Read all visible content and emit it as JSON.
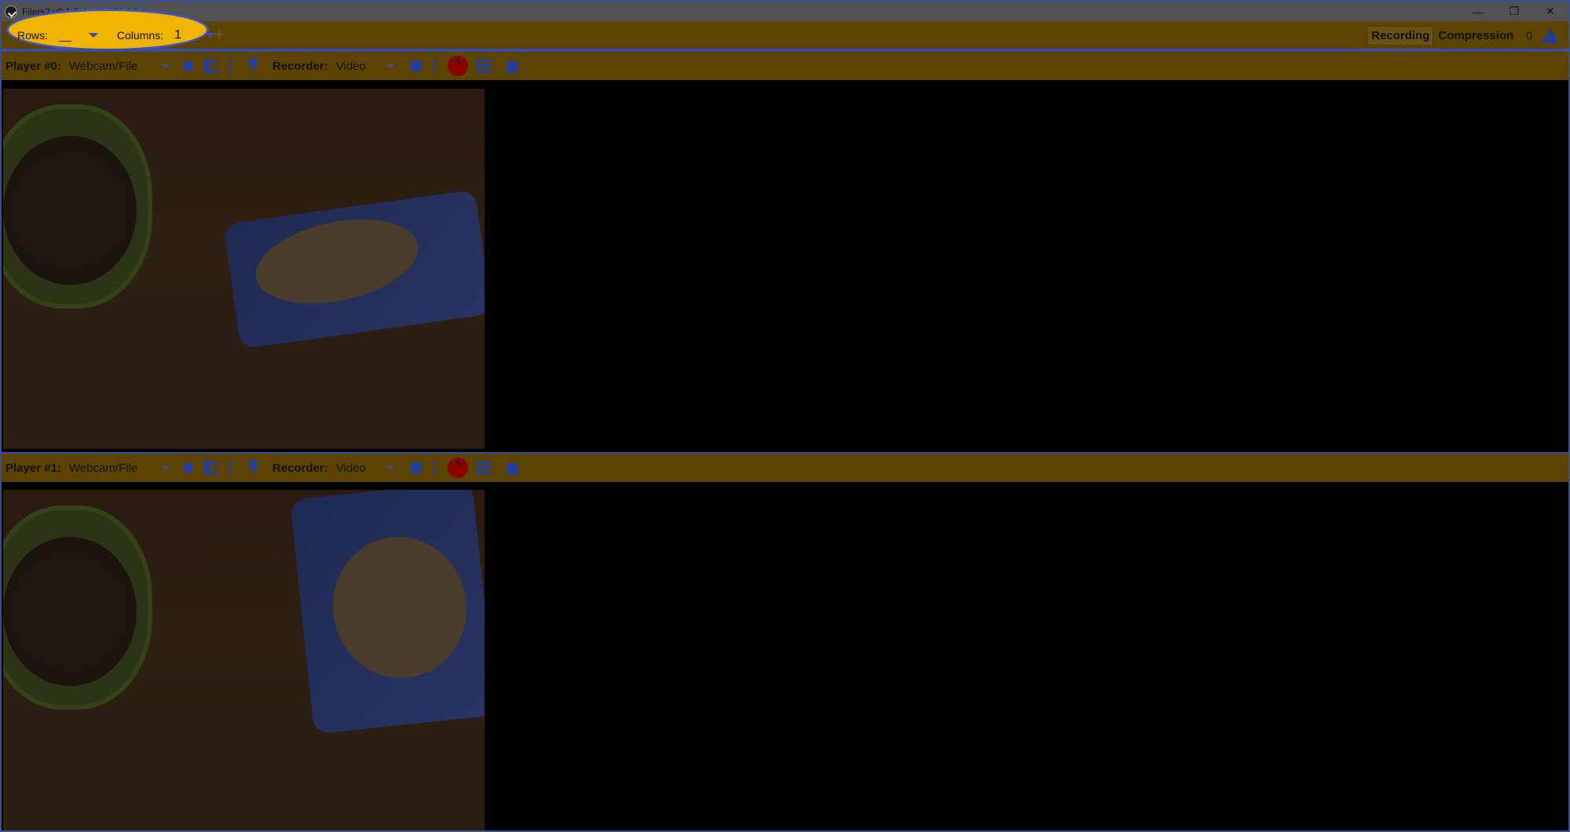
{
  "window": {
    "title": "Filers2 v0.1.0.dev0, CPL lab",
    "minimize_glyph": "—",
    "maximize_glyph": "❐",
    "close_glyph": "✕"
  },
  "toolbar": {
    "rows_label": "Rows:",
    "rows_value": "__",
    "columns_label": "Columns:",
    "columns_value": "1",
    "add_glyph": "+",
    "recording_tab": "Recording",
    "compression_tab": "Compression",
    "count": "0",
    "warning_icon": "warning-icon"
  },
  "players": [
    {
      "player_label": "Player #0:",
      "player_source": "Webcam/File",
      "recorder_label": "Recorder:",
      "recorder_type": "Video"
    },
    {
      "player_label": "Player #1:",
      "player_source": "Webcam/File",
      "recorder_label": "Recorder:",
      "recorder_type": "Video"
    }
  ],
  "colors": {
    "toolbar_bg": "#5c4400",
    "highlight": "#f0b400",
    "accent_blue": "#263d9a",
    "timer_red": "#8b0000"
  }
}
